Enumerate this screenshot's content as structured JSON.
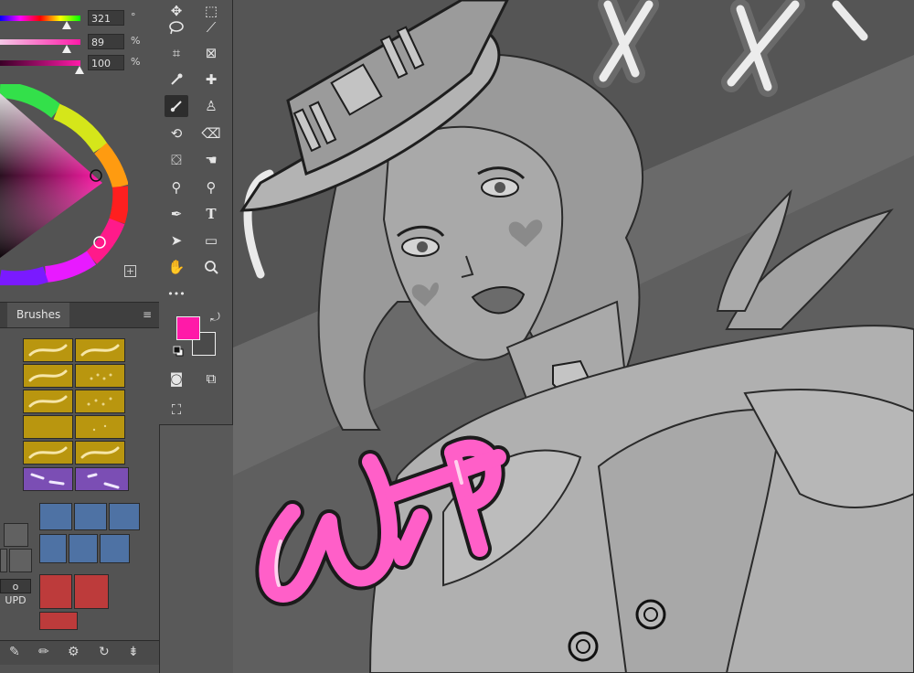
{
  "color_panel": {
    "sliders": [
      {
        "value": "321",
        "unit": "°"
      },
      {
        "value": "89",
        "unit": "%"
      },
      {
        "value": "100",
        "unit": "%"
      }
    ],
    "add_icon": "plus-square-icon"
  },
  "brushes_panel": {
    "tab_label": "Brushes",
    "menu_icon": "hamburger-menu-icon",
    "partial_label": "o UPD"
  },
  "toolbar": {
    "more_label": "•••",
    "foreground_color": "#ff1aa8",
    "background_color": "#4a4a4a"
  },
  "canvas": {
    "overlay_text": "WIP",
    "overlay_color": "#ff5fc8"
  },
  "colors": {
    "panel_bg": "#535353",
    "accent_gold": "#b9960f",
    "accent_purple": "#7b4eb4",
    "accent_blue": "#4e72a4",
    "accent_red": "#bd3b3b"
  }
}
